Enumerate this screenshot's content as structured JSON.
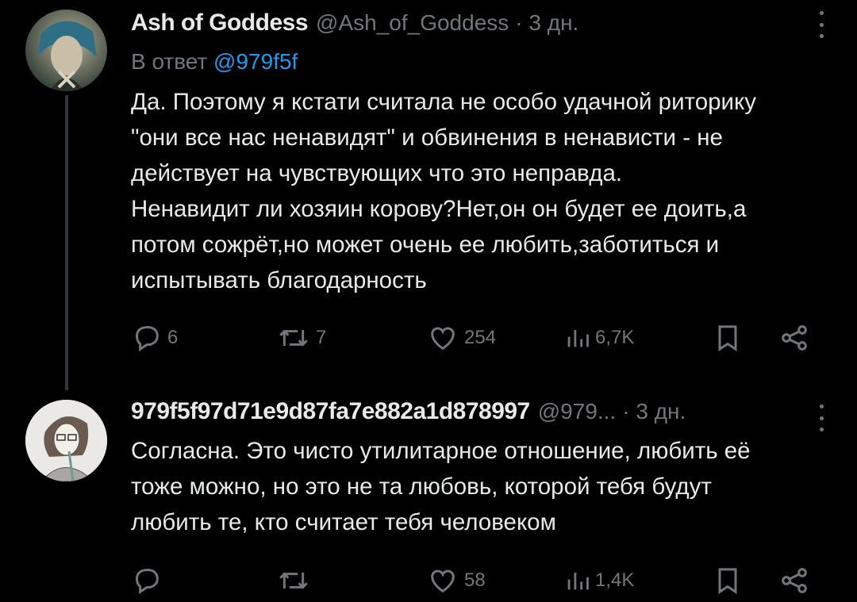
{
  "tweets": [
    {
      "name": "Ash of Goddess",
      "handle": "@Ash_of_Goddess",
      "time": "· 3 дн.",
      "reply_prefix": "В ответ",
      "reply_handle": "@979f5f",
      "lines": [
        "Да. Поэтому я кстати считала не особо удачной риторику",
        "\"они все нас ненавидят\" и обвинения в ненависти - не",
        "действует на чувствующих что это неправда.",
        "Ненавидит ли хозяин корову?Нет,он он будет ее доить,а",
        "потом сожрёт,но может очень ее любить,заботиться и",
        "испытывать благодарность"
      ],
      "replies": "6",
      "retweets": "7",
      "likes": "254",
      "views": "6,7K"
    },
    {
      "name": "979f5f97d71e9d87fa7e882a1d878997",
      "handle": "@979...",
      "time": "· 3 дн.",
      "lines": [
        "Согласна. Это чисто утилитарное отношение, любить её",
        "тоже можно, но это не та любовь, которой тебя будут",
        "любить те, кто считает тебя человеком"
      ],
      "replies": "",
      "retweets": "",
      "likes": "58",
      "views": "1,4K"
    }
  ],
  "icons": {
    "reply": "reply-icon",
    "retweet": "retweet-icon",
    "like": "heart-icon",
    "views": "views-icon",
    "bookmark": "bookmark-icon",
    "share": "share-icon",
    "more": "more-icon"
  },
  "colors": {
    "background": "#000000",
    "text": "#e7e9ea",
    "muted": "#71767b",
    "link": "#1d9bf0",
    "thread_line": "#333639"
  }
}
